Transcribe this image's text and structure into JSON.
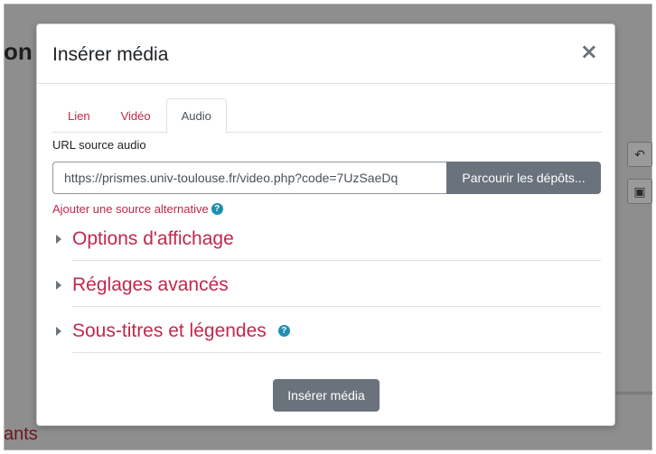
{
  "background": {
    "heading_fragment": "on",
    "bottom_fragment": "ants"
  },
  "modal": {
    "title": "Insérer média",
    "close_glyph": "×",
    "tabs": [
      {
        "label": "Lien",
        "active": false
      },
      {
        "label": "Vidéo",
        "active": false
      },
      {
        "label": "Audio",
        "active": true
      }
    ],
    "url_label": "URL source audio",
    "url_value": "https://prismes.univ-toulouse.fr/video.php?code=7UzSaeDq",
    "browse_label": "Parcourir les dépôts...",
    "alt_source_label": "Ajouter une source alternative",
    "help_glyph": "?",
    "sections": [
      {
        "label": "Options d'affichage",
        "help": false
      },
      {
        "label": "Réglages avancés",
        "help": false
      },
      {
        "label": "Sous-titres et légendes",
        "help": true
      }
    ],
    "insert_label": "Insérer média"
  },
  "colors": {
    "accent": "#c4264e",
    "button": "#6a737b",
    "help": "#1f8fb0"
  },
  "icons": {
    "close": "close-icon",
    "help": "question-circle-icon",
    "caret": "caret-right-icon",
    "undo": "undo-icon",
    "media": "media-icon"
  }
}
